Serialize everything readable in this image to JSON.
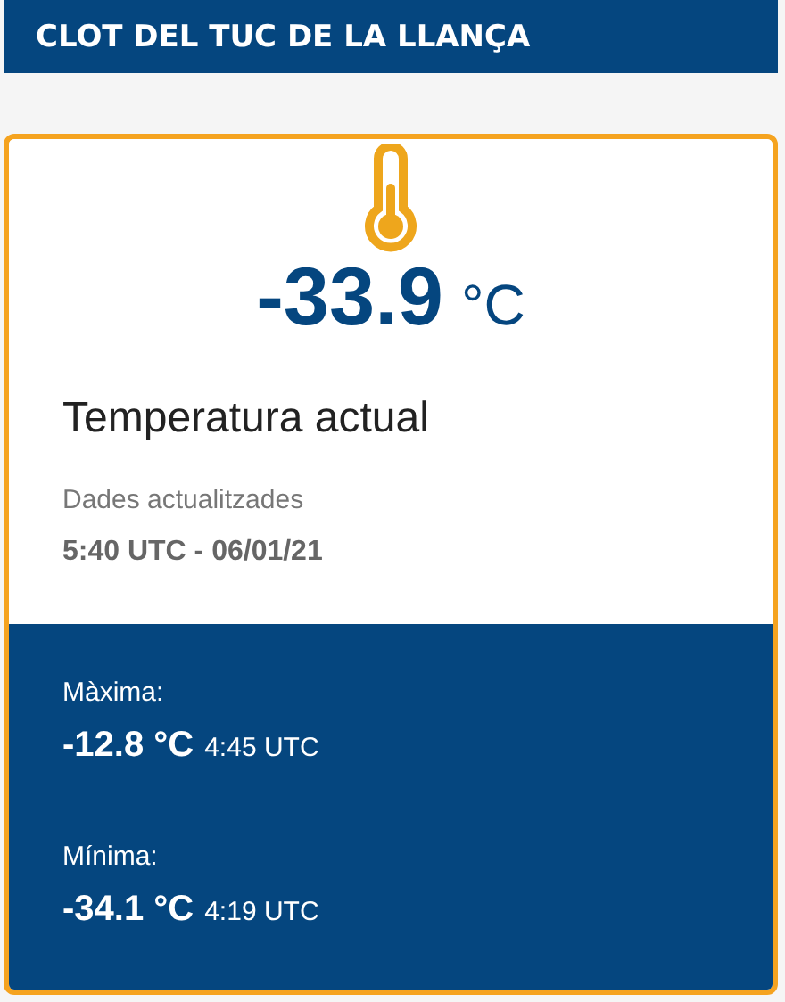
{
  "header": {
    "title": "CLOT DEL TUC DE LA LLANÇA"
  },
  "current": {
    "value": "-33.9",
    "unit": "°C",
    "label": "Temperatura actual",
    "updated_label": "Dades actualitzades",
    "updated_time": "5:40 UTC - 06/01/21"
  },
  "extremes": [
    {
      "label": "Màxima:",
      "value": "-12.8 °C",
      "time": "4:45 UTC"
    },
    {
      "label": "Mínima:",
      "value": "-34.1 °C",
      "time": "4:19 UTC"
    }
  ]
}
